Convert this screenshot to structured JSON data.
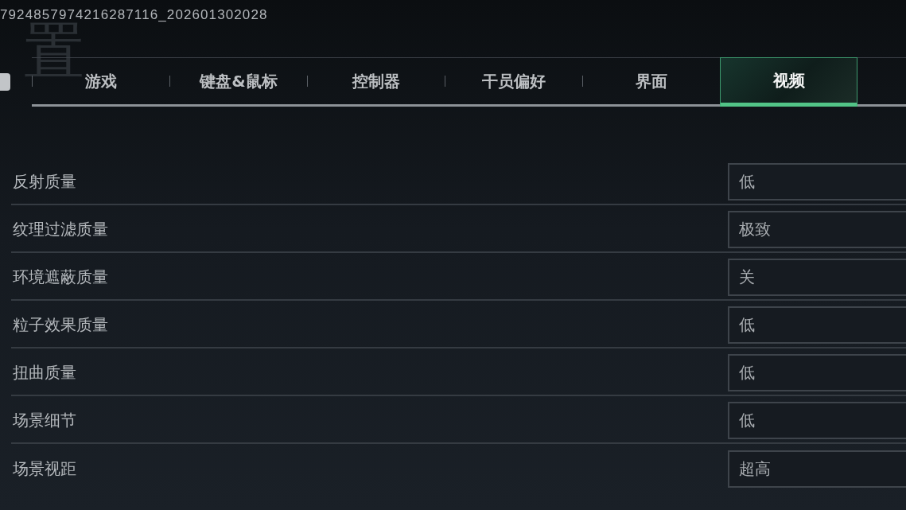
{
  "overlay_id": "7924857974216287116_202601302028",
  "page_title": "置",
  "tabs": [
    {
      "label": "游戏",
      "selected": false
    },
    {
      "label": "键盘&鼠标",
      "selected": false
    },
    {
      "label": "控制器",
      "selected": false
    },
    {
      "label": "干员偏好",
      "selected": false
    },
    {
      "label": "界面",
      "selected": false
    },
    {
      "label": "视频",
      "selected": true
    }
  ],
  "settings": [
    {
      "label": "反射质量",
      "value": "低"
    },
    {
      "label": "纹理过滤质量",
      "value": "极致"
    },
    {
      "label": "环境遮蔽质量",
      "value": "关"
    },
    {
      "label": "粒子效果质量",
      "value": "低"
    },
    {
      "label": "扭曲质量",
      "value": "低"
    },
    {
      "label": "场景细节",
      "value": "低"
    },
    {
      "label": "场景视距",
      "value": "超高"
    }
  ]
}
